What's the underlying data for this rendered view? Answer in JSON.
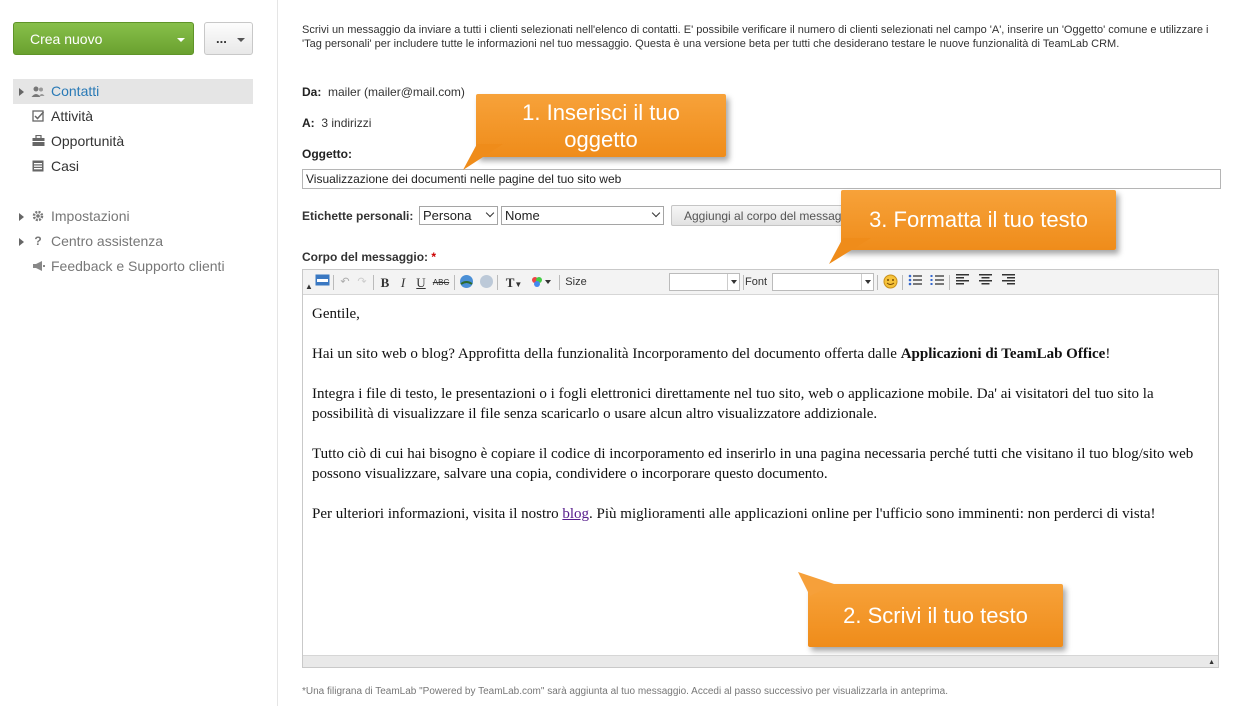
{
  "sidebar": {
    "create_label": "Crea nuovo",
    "more_label": "...",
    "items": [
      {
        "label": "Contatti",
        "icon": "contacts-icon"
      },
      {
        "label": "Attività",
        "icon": "tasks-icon"
      },
      {
        "label": "Opportunità",
        "icon": "opportunities-icon"
      },
      {
        "label": "Casi",
        "icon": "cases-icon"
      }
    ],
    "settings": [
      {
        "label": "Impostazioni",
        "icon": "gear-icon"
      },
      {
        "label": "Centro assistenza",
        "icon": "help-icon"
      },
      {
        "label": "Feedback e Supporto clienti",
        "icon": "megaphone-icon"
      }
    ]
  },
  "form": {
    "intro": "Scrivi un messaggio da inviare a tutti i clienti selezionati nell'elenco di contatti. E' possibile verificare il numero di clienti selezionati nel campo 'A', inserire un 'Oggetto' comune e utilizzare i 'Tag personali' per includere tutte le informazioni nel tuo messaggio. Questa è una versione beta per tutti che desiderano testare le nuove funzionalità di TeamLab CRM.",
    "from_label": "Da:",
    "from_value": "mailer (mailer@mail.com)",
    "to_label": "A:",
    "to_value": "3 indirizzi",
    "subject_label": "Oggetto:",
    "subject_value": "Visualizzazione dei documenti nelle pagine del tuo sito web",
    "tags_label": "Etichette personali:",
    "tag_type": "Persona",
    "tag_field": "Nome",
    "add_button": "Aggiungi al corpo del messaggio",
    "body_label": "Corpo del messaggio:",
    "required_mark": "*",
    "toolbar": {
      "size_label": "Size",
      "font_label": "Font"
    },
    "body": {
      "p1": "Gentile,",
      "p2_start": "Hai un sito web o blog? Approfitta della funzionalità Incorporamento del documento offerta dalle ",
      "p2_bold": "Applicazioni di TeamLab Office",
      "p2_end": "!",
      "p3": "Integra i file di testo, le presentazioni o i fogli elettronici direttamente nel tuo sito, web o applicazione mobile. Da' ai visitatori del tuo sito la possibilità di visualizzare il file senza scaricarlo o usare alcun altro visualizzatore addizionale.",
      "p4": "Tutto ciò di cui hai bisogno è copiare il codice di incorporamento ed inserirlo in una pagina necessaria perché tutti che visitano il tuo blog/sito web possono visualizzare, salvare una copia, condividere o incorporare questo documento.",
      "p5_start": "Per ulteriori informazioni, visita il nostro ",
      "p5_link": "blog",
      "p5_end": ". Più miglioramenti alle applicazioni online per l'ufficio sono imminenti: non perderci di vista!"
    },
    "footnote": "*Una filigrana di TeamLab \"Powered by TeamLab.com\" sarà aggiunta al tuo messaggio. Accedi al passo successivo per visualizzarla in anteprima."
  },
  "callouts": {
    "c1": "1. Inserisci il tuo oggetto",
    "c2": "2. Scrivi il tuo testo",
    "c3": "3. Formatta il tuo testo"
  },
  "colors": {
    "accent": "#2a7ab6",
    "create_button": "#78b03c",
    "callout": "#f39a2a"
  }
}
